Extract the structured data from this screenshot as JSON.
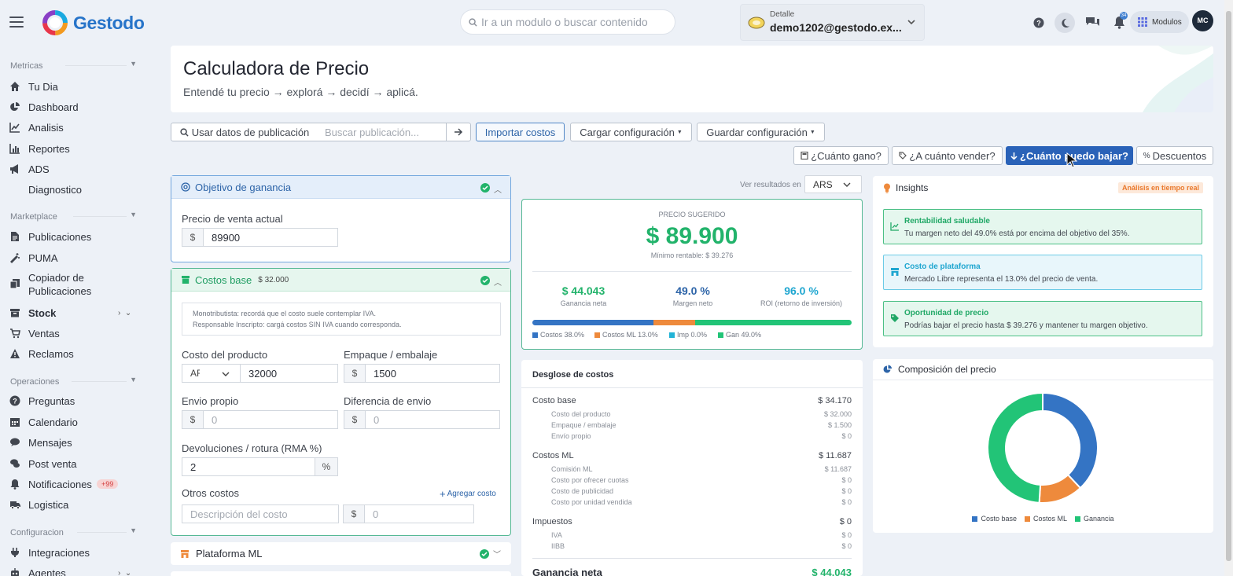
{
  "app": {
    "logo_text": "Gestodo"
  },
  "topbar": {
    "search_placeholder": "Ir a un modulo o buscar contenido",
    "account_label": "Detalle",
    "account_email": "demo1202@gestodo.ex...",
    "bell_count": "34",
    "modulos_label": "Modulos",
    "avatar_initials": "MC"
  },
  "sidebar": {
    "sections": [
      {
        "title": "Metricas",
        "items": [
          {
            "label": "Tu Dia",
            "icon": "home-icon"
          },
          {
            "label": "Dashboard",
            "icon": "pie-icon"
          },
          {
            "label": "Analisis",
            "icon": "line-chart-icon"
          },
          {
            "label": "Reportes",
            "icon": "bar-chart-icon"
          },
          {
            "label": "ADS",
            "icon": "megaphone-icon"
          },
          {
            "label": "Diagnostico",
            "icon": ""
          }
        ]
      },
      {
        "title": "Marketplace",
        "items": [
          {
            "label": "Publicaciones",
            "icon": "file-icon"
          },
          {
            "label": "PUMA",
            "icon": "magic-wand-icon"
          },
          {
            "label": "Copiador de",
            "label2": "Publicaciones",
            "icon": "copy-icon"
          },
          {
            "label": "Stock",
            "icon": "box-icon"
          },
          {
            "label": "Ventas",
            "icon": "cart-icon"
          },
          {
            "label": "Reclamos",
            "icon": "warning-icon"
          }
        ]
      },
      {
        "title": "Operaciones",
        "items": [
          {
            "label": "Preguntas",
            "icon": "question-icon"
          },
          {
            "label": "Calendario",
            "icon": "calendar-icon"
          },
          {
            "label": "Mensajes",
            "icon": "chat-icon"
          },
          {
            "label": "Post venta",
            "icon": "comments-icon"
          },
          {
            "label": "Notificaciones",
            "badge": "+99",
            "icon": "bell-icon"
          },
          {
            "label": "Logistica",
            "icon": "truck-icon"
          }
        ]
      },
      {
        "title": "Configuracion",
        "items": [
          {
            "label": "Integraciones",
            "icon": "plug-icon"
          },
          {
            "label": "Agentes",
            "icon": "robot-icon"
          }
        ]
      }
    ]
  },
  "header": {
    "title": "Calculadora de Precio",
    "subtitle": "Entendé tu precio → explorá → decidí → aplicá."
  },
  "toolbar": {
    "use_pub": "Usar datos de publicación",
    "pub_placeholder": "Buscar publicación...",
    "import": "Importar costos",
    "load_config": "Cargar configuración",
    "save_config": "Guardar configuración",
    "mode_gano": "¿Cuánto gano?",
    "mode_vender": "¿A cuánto vender?",
    "mode_bajar": "¿Cuánto puedo bajar?",
    "mode_desc": "Descuentos"
  },
  "objetivo": {
    "title": "Objetivo de ganancia",
    "price_label": "Precio de venta actual",
    "price_prefix": "$",
    "price_value": "89900"
  },
  "costos": {
    "title": "Costos base",
    "total": "$ 32.000",
    "note1": "Monotributista: recordá que el costo suele contemplar IVA.",
    "note2": "Responsable Inscripto: cargá costos SIN IVA cuando corresponda.",
    "producto_label": "Costo del producto",
    "producto_currency": "ARS",
    "producto_value": "32000",
    "empaque_label": "Empaque / embalaje",
    "empaque_prefix": "$",
    "empaque_value": "1500",
    "envio_label": "Envio propio",
    "envio_prefix": "$",
    "envio_placeholder": "0",
    "diferencia_label": "Diferencia de envio",
    "diferencia_prefix": "$",
    "diferencia_placeholder": "0",
    "rma_label": "Devoluciones / rotura (RMA %)",
    "rma_value": "2",
    "rma_suffix": "%",
    "otros_label": "Otros costos",
    "agregar": "Agregar costo",
    "otros_desc_placeholder": "Descripción del costo",
    "otros_prefix": "$",
    "otros_val_placeholder": "0"
  },
  "plataforma": {
    "title": "Plataforma ML"
  },
  "results": {
    "ver_label": "Ver resultados en",
    "currency": "ARS",
    "precio_label": "PRECIO SUGERIDO",
    "precio": "$ 89.900",
    "minimo": "Mínimo rentable: $ 39.276",
    "ganancia": "$ 44.043",
    "ganancia_label": "Ganancia neta",
    "margen": "49.0 %",
    "margen_label": "Margen neto",
    "roi": "96.0 %",
    "roi_label": "ROI (retorno de inversión)",
    "breakdown": [
      {
        "label": "Costos 38.0%",
        "pct": 38.0,
        "color": "#3474c4"
      },
      {
        "label": "Costos ML 13.0%",
        "pct": 13.0,
        "color": "#ee8a3c"
      },
      {
        "label": "Imp 0.0%",
        "pct": 0.0,
        "color": "#22b3d6"
      },
      {
        "label": "Gan 49.0%",
        "pct": 49.0,
        "color": "#22c477"
      }
    ]
  },
  "desglose": {
    "title": "Desglose de costos",
    "groups": [
      {
        "label": "Costo base",
        "value": "$ 34.170",
        "items": [
          {
            "label": "Costo del producto",
            "value": "$ 32.000"
          },
          {
            "label": "Empaque / embalaje",
            "value": "$ 1.500"
          },
          {
            "label": "Envío propio",
            "value": "$ 0"
          }
        ]
      },
      {
        "label": "Costos ML",
        "value": "$ 11.687",
        "items": [
          {
            "label": "Comisión ML",
            "value": "$ 11.687"
          },
          {
            "label": "Costo por ofrecer cuotas",
            "value": "$ 0"
          },
          {
            "label": "Costo de publicidad",
            "value": "$ 0"
          },
          {
            "label": "Costo por unidad vendida",
            "value": "$ 0"
          }
        ]
      },
      {
        "label": "Impuestos",
        "value": "$ 0",
        "items": [
          {
            "label": "IVA",
            "value": "$ 0"
          },
          {
            "label": "IIBB",
            "value": "$ 0"
          }
        ]
      }
    ],
    "total_label": "Ganancia neta",
    "total_value": "$ 44.043"
  },
  "insights": {
    "title": "Insights",
    "badge": "Análisis en tiempo real",
    "items": [
      {
        "title": "Rentabilidad saludable",
        "text": "Tu margen neto del 49.0% está por encima del objetivo del 35%.",
        "color": "#20a866",
        "bg": "#e5f7ee",
        "border": "#4cc086"
      },
      {
        "title": "Costo de plataforma",
        "text": "Mercado Libre representa el 13.0% del precio de venta.",
        "color": "#1fa6d0",
        "bg": "#e8f6fb",
        "border": "#6ccbe6"
      },
      {
        "title": "Oportunidad de precio",
        "text": "Podrías bajar el precio hasta $ 39.276 y mantener tu margen objetivo.",
        "color": "#20a866",
        "bg": "#e5f7ee",
        "border": "#4cc086"
      }
    ]
  },
  "composicion": {
    "title": "Composición del precio"
  },
  "chart_data": {
    "type": "pie",
    "title": "Composición del precio",
    "categories": [
      "Costo base",
      "Costos ML",
      "Ganancia"
    ],
    "values": [
      38.0,
      13.0,
      49.0
    ],
    "colors": [
      "#3474c4",
      "#ee8a3c",
      "#22c477"
    ],
    "legend": "bottom"
  }
}
